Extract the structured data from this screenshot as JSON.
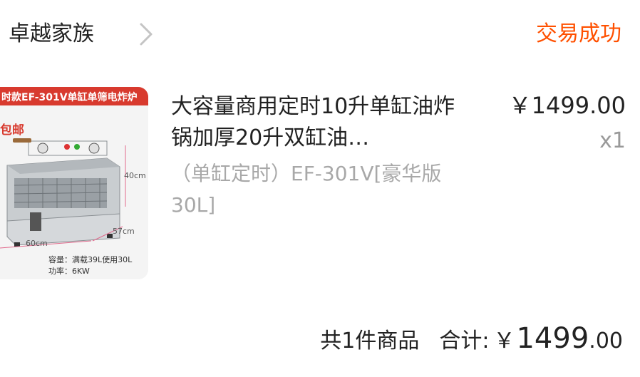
{
  "store": {
    "name": "卓越家族",
    "order_status": "交易成功"
  },
  "product": {
    "image_texts": {
      "banner": "时款EF-301V单缸单筛电炸炉",
      "promo": "包邮",
      "height_dim": "40cm",
      "depth_dim": "57cm",
      "width_dim": "60cm",
      "capacity": "容量：满载39L使用30L",
      "power": "功率：6KW"
    },
    "title": "大容量商用定时10升单缸油炸锅加厚20升双缸油…",
    "sku": "（单缸定时）EF-301V[豪华版30L]",
    "price": "￥1499.00",
    "quantity": "x1"
  },
  "summary": {
    "count": "共1件商品",
    "total_label": "合计:",
    "currency": "￥",
    "total_int": "1499",
    "total_dec": ".00"
  },
  "colors": {
    "status": "#ff5000",
    "muted": "#a8a8a8",
    "banner": "#d83a2e"
  }
}
